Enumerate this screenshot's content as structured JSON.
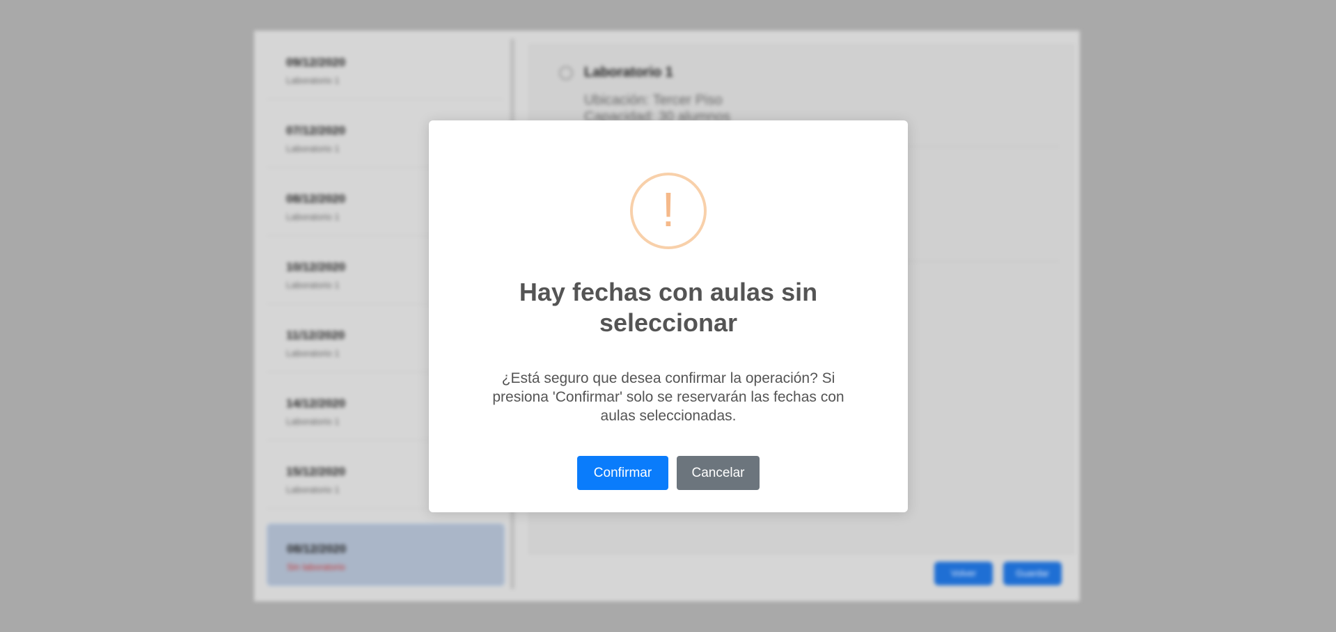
{
  "background": {
    "sidebar_items": [
      {
        "date": "09/12/2020",
        "sub": "Laboratorio 1",
        "active": false
      },
      {
        "date": "07/12/2020",
        "sub": "Laboratorio 1",
        "active": false
      },
      {
        "date": "08/12/2020",
        "sub": "Laboratorio 1",
        "active": false
      },
      {
        "date": "10/12/2020",
        "sub": "Laboratorio 1",
        "active": false
      },
      {
        "date": "11/12/2020",
        "sub": "Laboratorio 1",
        "active": false
      },
      {
        "date": "14/12/2020",
        "sub": "Laboratorio 1",
        "active": false
      },
      {
        "date": "15/12/2020",
        "sub": "Laboratorio 1",
        "active": false
      },
      {
        "date": "08/12/2020",
        "sub": "Sin laboratorio",
        "active": true
      }
    ],
    "card": {
      "title": "Laboratorio 1",
      "line1": "Ubicación: Tercer Piso",
      "line2": "Capacidad: 30 alumnos"
    },
    "footer_buttons": [
      "Volver",
      "Guardar"
    ]
  },
  "modal": {
    "icon": "warning-icon",
    "icon_glyph": "!",
    "icon_color": "#f8bb86",
    "title": "Hay fechas con aulas sin seleccionar",
    "text": "¿Está seguro que desea confirmar la operación? Si presiona 'Confirmar' solo se reservarán las fechas con aulas seleccionadas.",
    "confirm_label": "Confirmar",
    "cancel_label": "Cancelar",
    "confirm_color": "#0a7cfb",
    "cancel_color": "#6c757d"
  }
}
